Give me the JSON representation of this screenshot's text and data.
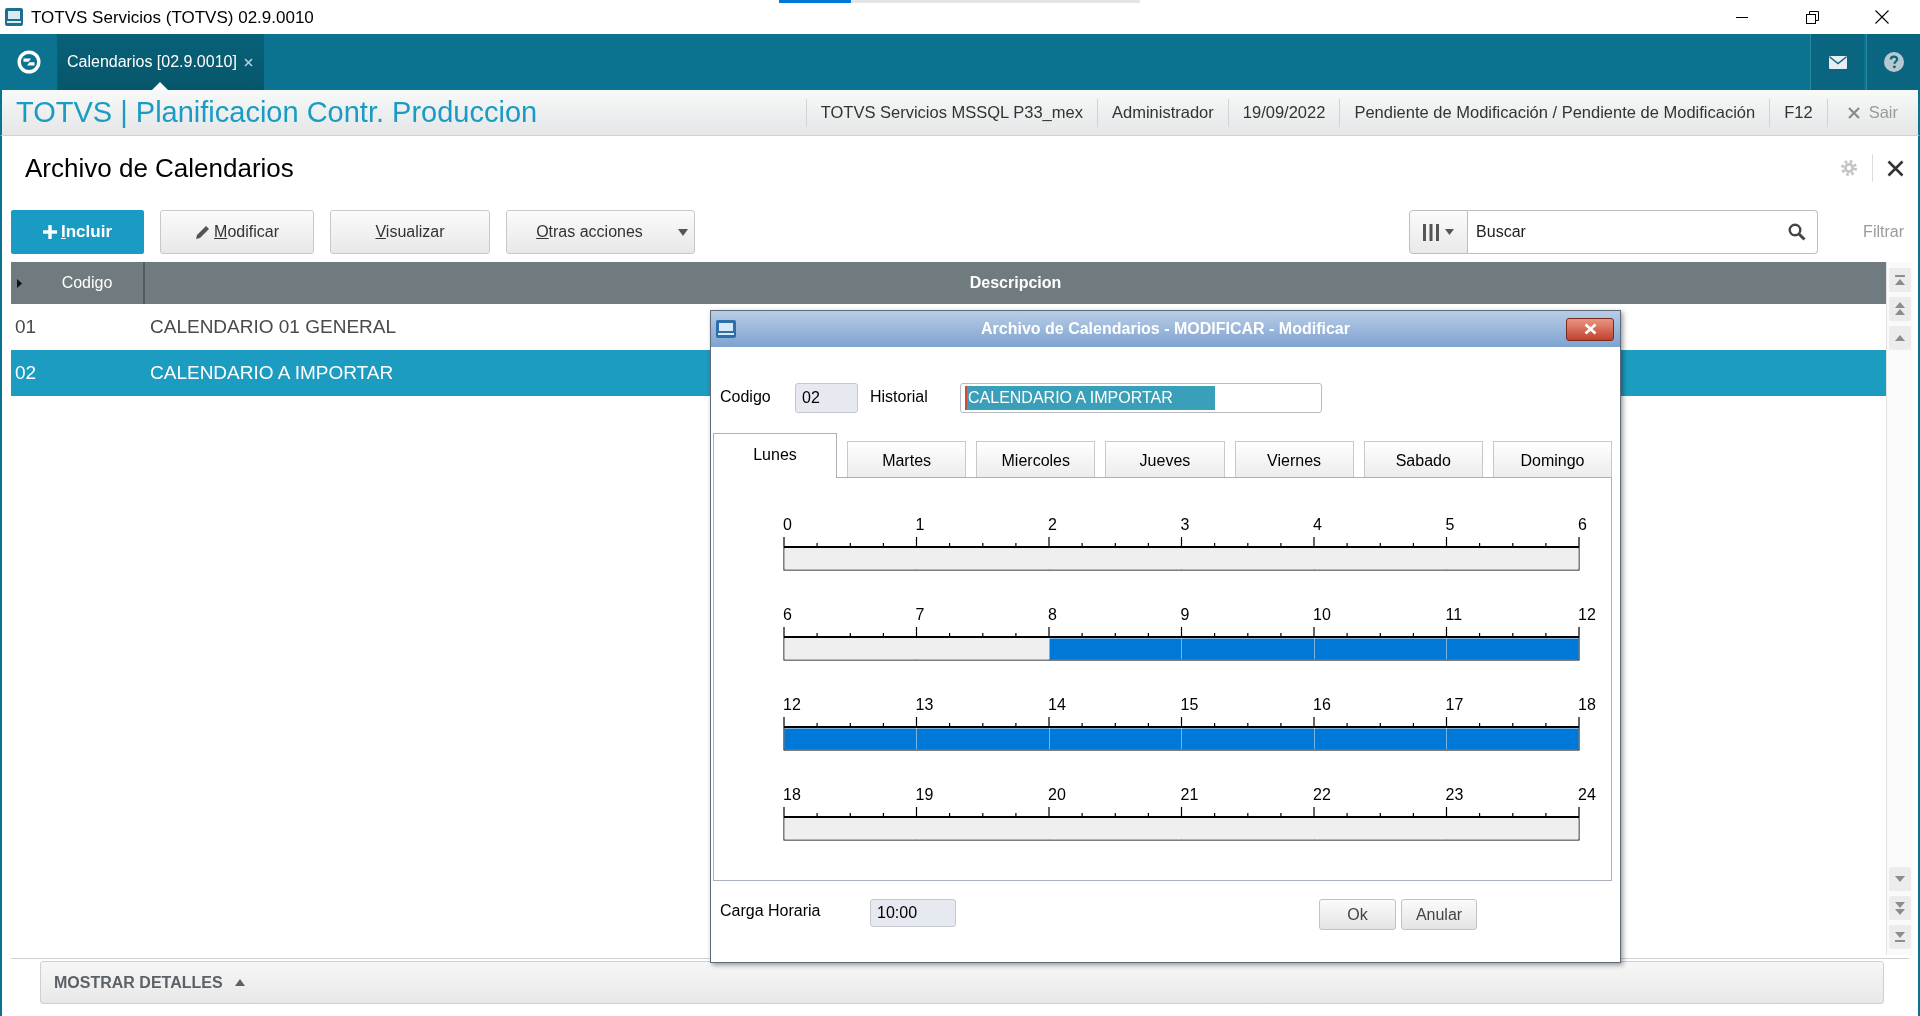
{
  "window": {
    "title": "TOTVS Servicios (TOTVS) 02.9.0010"
  },
  "app_tabs": [
    {
      "label": "Calendarios [02.9.0010]",
      "selected": true
    }
  ],
  "header": {
    "title": "TOTVS | Planificacion Contr. Produccion",
    "info": [
      "TOTVS Servicios MSSQL P33_mex",
      "Administrador",
      "19/09/2022",
      "Pendiente de Modificación / Pendiente de Modificación",
      "F12"
    ],
    "exit": "Sair"
  },
  "page": {
    "title": "Archivo de Calendarios"
  },
  "toolbar": {
    "buttons": [
      {
        "label": "Incluir",
        "kind": "primary"
      },
      {
        "label": "Modificar",
        "kind": "edit"
      },
      {
        "label": "Visualizar",
        "kind": "plain"
      },
      {
        "label": "Otras acciones",
        "kind": "dropdown"
      }
    ],
    "search": {
      "placeholder": "Buscar"
    },
    "filter": "Filtrar"
  },
  "table": {
    "columns": [
      "Codigo",
      "Descripcion"
    ],
    "rows": [
      {
        "cells": [
          "01",
          "CALENDARIO 01 GENERAL"
        ],
        "selected": false
      },
      {
        "cells": [
          "02",
          "CALENDARIO A IMPORTAR"
        ],
        "selected": true
      }
    ]
  },
  "details": {
    "label": "MOSTRAR DETALLES"
  },
  "dialog": {
    "title": "Archivo de Calendarios - MODIFICAR - Modificar",
    "fields": [
      {
        "label": "Codigo",
        "value": "02",
        "disabled": true,
        "highlighted": false
      },
      {
        "label": "Historial",
        "value": "CALENDARIO A IMPORTAR",
        "disabled": false,
        "highlighted": true
      }
    ],
    "day_tabs": [
      {
        "label": "Lunes",
        "selected": true
      },
      {
        "label": "Martes",
        "selected": false
      },
      {
        "label": "Miercoles",
        "selected": false
      },
      {
        "label": "Jueves",
        "selected": false
      },
      {
        "label": "Viernes",
        "selected": false
      },
      {
        "label": "Sabado",
        "selected": false
      },
      {
        "label": "Domingo",
        "selected": false
      }
    ],
    "schedule": [
      {
        "ticks": [
          "0",
          "1",
          "2",
          "3",
          "4",
          "5",
          "6"
        ],
        "hours": [
          {
            "on": false
          },
          {
            "on": false
          },
          {
            "on": false
          },
          {
            "on": false
          },
          {
            "on": false
          },
          {
            "on": false
          }
        ]
      },
      {
        "ticks": [
          "6",
          "7",
          "8",
          "9",
          "10",
          "11",
          "12"
        ],
        "hours": [
          {
            "on": false
          },
          {
            "on": false
          },
          {
            "on": true
          },
          {
            "on": true
          },
          {
            "on": true
          },
          {
            "on": true
          }
        ]
      },
      {
        "ticks": [
          "12",
          "13",
          "14",
          "15",
          "16",
          "17",
          "18"
        ],
        "hours": [
          {
            "on": true
          },
          {
            "on": true
          },
          {
            "on": true
          },
          {
            "on": true
          },
          {
            "on": true
          },
          {
            "on": true
          }
        ]
      },
      {
        "ticks": [
          "18",
          "19",
          "20",
          "21",
          "22",
          "23",
          "24"
        ],
        "hours": [
          {
            "on": false
          },
          {
            "on": false
          },
          {
            "on": false
          },
          {
            "on": false
          },
          {
            "on": false
          },
          {
            "on": false
          }
        ]
      }
    ],
    "workload": {
      "label": "Carga Horaria",
      "value": "10:00",
      "disabled": true
    },
    "buttons": [
      "Ok",
      "Anular"
    ]
  }
}
